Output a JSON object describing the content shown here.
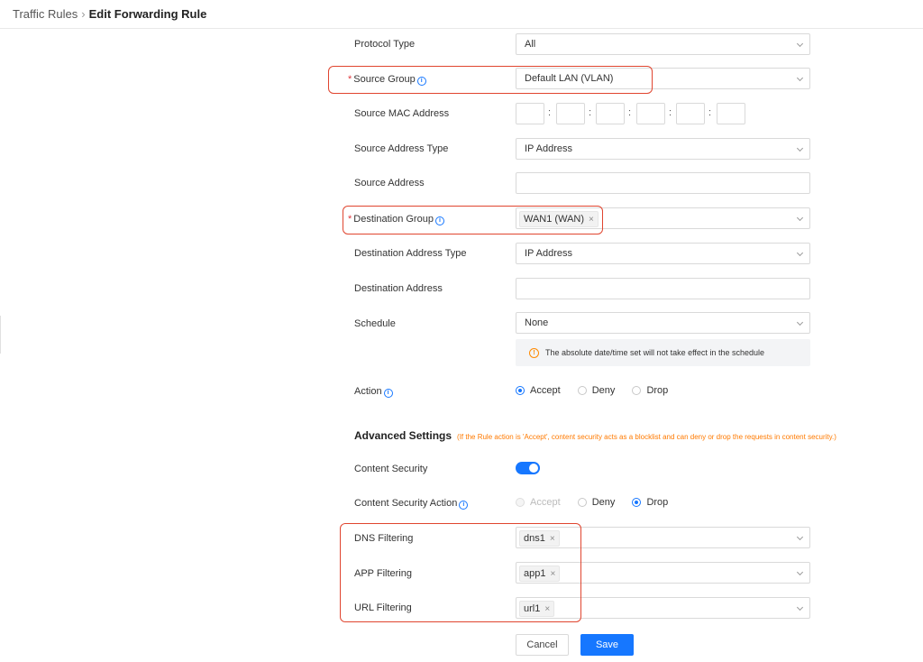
{
  "breadcrumb": {
    "parent": "Traffic Rules",
    "separator": "›",
    "current": "Edit Forwarding Rule"
  },
  "form": {
    "protocol_type": {
      "label": "Protocol Type",
      "value": "All"
    },
    "source_group": {
      "label": "Source Group",
      "required_mark": "*",
      "value": "Default LAN (VLAN)"
    },
    "source_mac": {
      "label": "Source MAC Address",
      "separator": ":"
    },
    "source_address_type": {
      "label": "Source Address Type",
      "value": "IP Address"
    },
    "source_address": {
      "label": "Source Address",
      "value": ""
    },
    "destination_group": {
      "label": "Destination Group",
      "required_mark": "*",
      "tag": "WAN1 (WAN)"
    },
    "destination_address_type": {
      "label": "Destination Address Type",
      "value": "IP Address"
    },
    "destination_address": {
      "label": "Destination Address",
      "value": ""
    },
    "schedule": {
      "label": "Schedule",
      "value": "None",
      "notice": "The absolute date/time set will not take effect in the schedule"
    },
    "action": {
      "label": "Action",
      "options": [
        "Accept",
        "Deny",
        "Drop"
      ],
      "selected": "Accept"
    }
  },
  "advanced": {
    "title": "Advanced Settings",
    "note": "(If the Rule action is 'Accept', content security acts as a blocklist and can deny or drop the requests in content security.)",
    "content_security": {
      "label": "Content Security",
      "enabled": true
    },
    "content_security_action": {
      "label": "Content Security Action",
      "options": [
        "Accept",
        "Deny",
        "Drop"
      ],
      "selected": "Drop",
      "disabled": "Accept"
    },
    "dns_filtering": {
      "label": "DNS Filtering",
      "tag": "dns1"
    },
    "app_filtering": {
      "label": "APP Filtering",
      "tag": "app1"
    },
    "url_filtering": {
      "label": "URL Filtering",
      "tag": "url1"
    }
  },
  "buttons": {
    "cancel": "Cancel",
    "save": "Save"
  },
  "icons": {
    "info": "info-icon",
    "warning": "warning-icon",
    "tag_remove": "×"
  },
  "colors": {
    "accent": "#1677ff",
    "required": "#e0393e",
    "warning": "#ff7a00",
    "highlight": "#e0452f"
  }
}
